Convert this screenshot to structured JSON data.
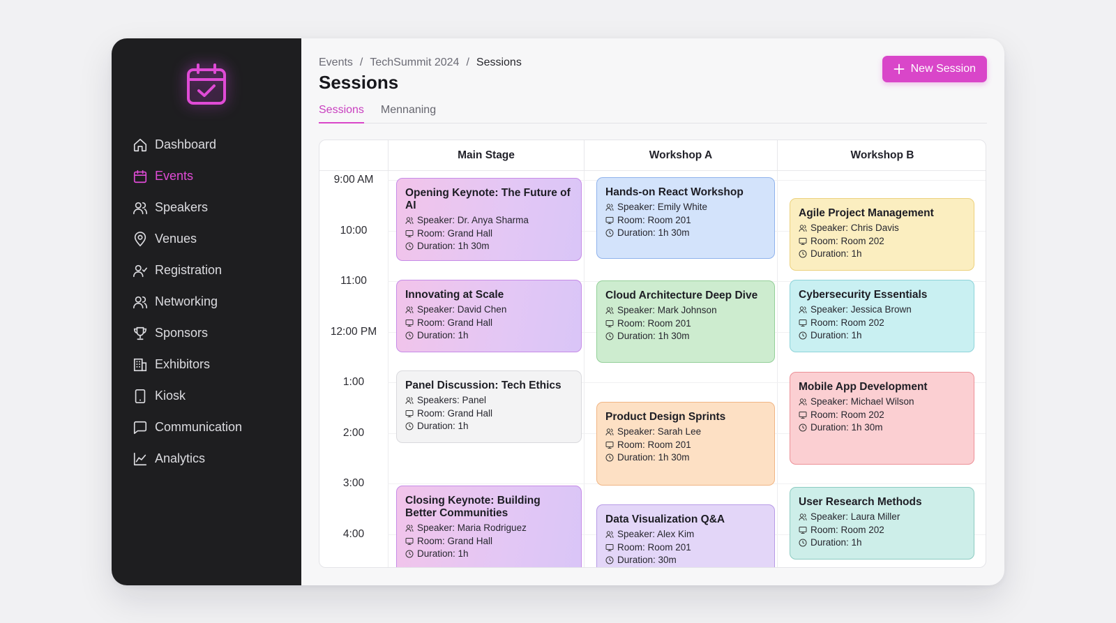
{
  "sidebar": {
    "items": [
      {
        "label": "Dashboard",
        "icon": "home-icon",
        "active": false
      },
      {
        "label": "Events",
        "icon": "calendar-icon",
        "active": true
      },
      {
        "label": "Speakers",
        "icon": "users-icon",
        "active": false
      },
      {
        "label": "Venues",
        "icon": "map-pin-icon",
        "active": false
      },
      {
        "label": "Registration",
        "icon": "user-check-icon",
        "active": false
      },
      {
        "label": "Networking",
        "icon": "users-icon",
        "active": false
      },
      {
        "label": "Sponsors",
        "icon": "trophy-icon",
        "active": false
      },
      {
        "label": "Exhibitors",
        "icon": "building-icon",
        "active": false
      },
      {
        "label": "Kiosk",
        "icon": "tablet-icon",
        "active": false
      },
      {
        "label": "Communication",
        "icon": "message-icon",
        "active": false
      },
      {
        "label": "Analytics",
        "icon": "chart-line-icon",
        "active": false
      }
    ]
  },
  "breadcrumb": [
    "Events",
    "TechSummit 2024",
    "Sessions"
  ],
  "page_title": "Sessions",
  "new_session_label": "New Session",
  "tabs": [
    "Sessions",
    "Mennaning"
  ],
  "schedule": {
    "columns": [
      "Main Stage",
      "Workshop A",
      "Workshop B"
    ],
    "times": [
      "9:00 AM",
      "10:00",
      "11:00",
      "12:00 PM",
      "1:00",
      "2:00",
      "3:00",
      "4:00"
    ],
    "sessions": [
      {
        "title": "Opening Keynote: The Future of AI",
        "speaker": "Speaker: Dr. Anya Sharma",
        "room": "Room: Grand Hall",
        "duration": "Duration: 1h 30m",
        "color": "pink"
      },
      {
        "title": "Innovating at Scale",
        "speaker": "Speaker: David Chen",
        "room": "Room: Grand Hall",
        "duration": "Duration: 1h",
        "color": "pink"
      },
      {
        "title": "Panel Discussion: Tech Ethics",
        "speaker": "Speakers: Panel",
        "room": "Room: Grand Hall",
        "duration": "Duration: 1h",
        "color": "gray"
      },
      {
        "title": "Closing Keynote: Building Better Communities",
        "speaker": "Speaker: Maria Rodriguez",
        "room": "Room: Grand Hall",
        "duration": "Duration: 1h",
        "color": "pink"
      },
      {
        "title": "Hands-on React Workshop",
        "speaker": "Speaker: Emily White",
        "room": "Room: Room 201",
        "duration": "Duration: 1h 30m",
        "color": "blue"
      },
      {
        "title": "Cloud Architecture Deep Dive",
        "speaker": "Speaker: Mark Johnson",
        "room": "Room: Room 201",
        "duration": "Duration: 1h 30m",
        "color": "green"
      },
      {
        "title": "Product Design Sprints",
        "speaker": "Speaker: Sarah Lee",
        "room": "Room: Room 201",
        "duration": "Duration: 1h 30m",
        "color": "peach"
      },
      {
        "title": "Data Visualization Q&A",
        "speaker": "Speaker: Alex Kim",
        "room": "Room: Room 201",
        "duration": "Duration: 30m",
        "color": "lavender"
      },
      {
        "title": "Agile Project Management",
        "speaker": "Speaker: Chris Davis",
        "room": "Room: Room 202",
        "duration": "Duration: 1h",
        "color": "yellow"
      },
      {
        "title": "Cybersecurity Essentials",
        "speaker": "Speaker: Jessica Brown",
        "room": "Room: Room 202",
        "duration": "Duration: 1h",
        "color": "cyan"
      },
      {
        "title": "Mobile App Development",
        "speaker": "Speaker: Michael Wilson",
        "room": "Room: Room 202",
        "duration": "Duration: 1h 30m",
        "color": "red"
      },
      {
        "title": "User Research Methods",
        "speaker": "Speaker: Laura Miller",
        "room": "Room: Room 202",
        "duration": "Duration: 1h",
        "color": "teal"
      }
    ]
  },
  "colors": {
    "accent": "#d946c9",
    "sidebar_bg": "#1e1e20"
  }
}
